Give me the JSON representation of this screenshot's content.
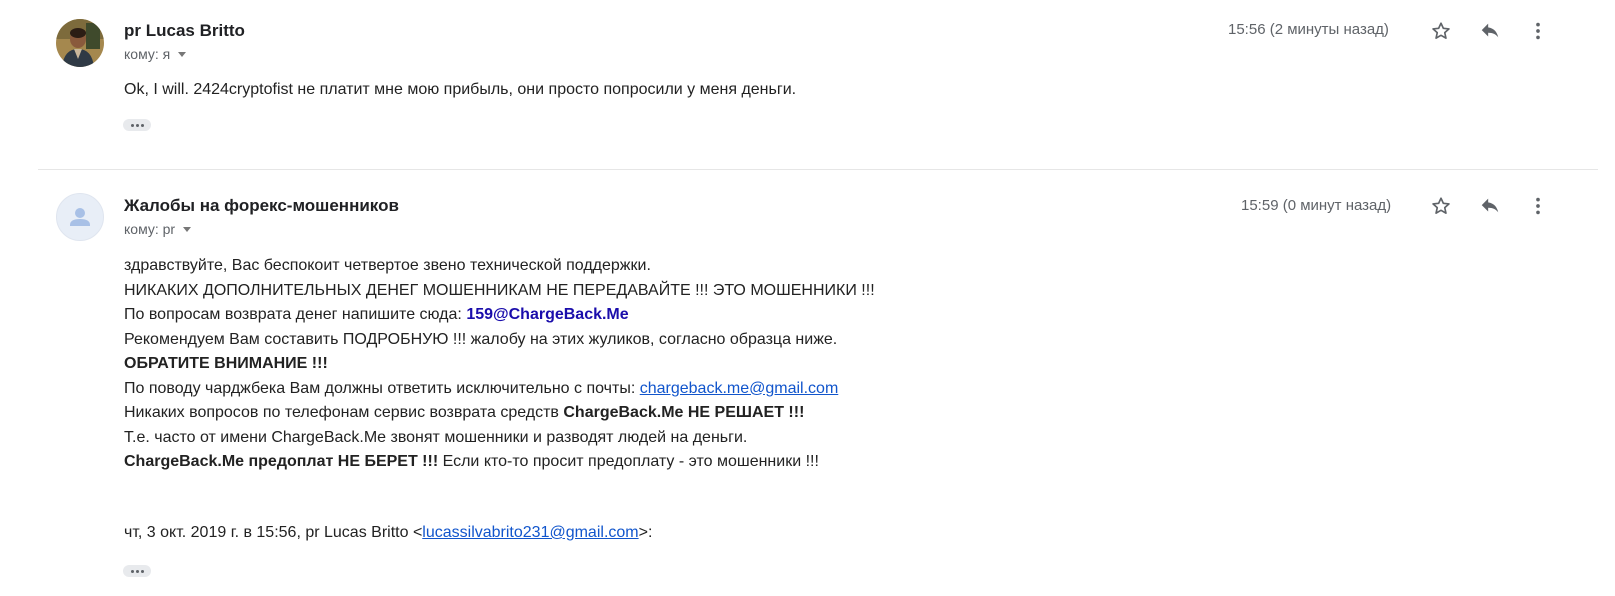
{
  "messages": [
    {
      "sender": "pr Lucas Britto",
      "to_label": "кому: я",
      "time": "15:56 (2 минуты назад)",
      "body": "Ok, I will. 2424cryptofist не платит мне мою прибыль, они просто попросили у меня деньги."
    },
    {
      "sender": "Жалобы на форекс-мошенников",
      "to_label": "кому: pr",
      "time": "15:59 (0 минут назад)",
      "lines": {
        "l1": "здравствуйте, Вас беспокоит четвертое звено технической поддержки.",
        "l2": "НИКАКИХ ДОПОЛНИТЕЛЬНЫХ ДЕНЕГ МОШЕННИКАМ НЕ ПЕРЕДАВАЙТЕ !!! ЭТО МОШЕННИКИ !!!",
        "l3_prefix": "По вопросам возврата денег напишите сюда: ",
        "l3_email": "159@ChargeBack.Me",
        "l4": "Рекомендуем Вам составить ПОДРОБНУЮ !!! жалобу на этих жуликов, согласно образца ниже.",
        "l5": "ОБРАТИТЕ ВНИМАНИЕ !!!",
        "l6_prefix": "По поводу чарджбека Вам должны ответить исключительно с почты: ",
        "l6_link": "chargeback.me@gmail.com",
        "l7_prefix": "Никаких вопросов по телефонам сервис возврата средств ",
        "l7_bold": "ChargeBack.Me НЕ РЕШАЕТ !!!",
        "l8": "Т.е. часто от имени ChargeBack.Me звонят мошенники и разводят людей на деньги.",
        "l9_bold": "ChargeBack.Me предоплат НЕ БЕРЕТ !!!",
        "l9_suffix": " Если кто-то просит предоплату - это мошенники !!!"
      },
      "quote": {
        "prefix": "чт, 3 окт. 2019 г. в 15:56, pr Lucas Britto <",
        "email": "lucassilvabrito231@gmail.com",
        "suffix": ">:"
      }
    }
  ],
  "icons": {
    "star": "star-outline-icon",
    "reply": "reply-arrow-icon",
    "more": "more-vert-icon",
    "avatar_placeholder": "person-silhouette-icon"
  },
  "colors": {
    "link": "#1155cc",
    "bold_email": "#1a0dab",
    "secondary_text": "#5f6368"
  }
}
